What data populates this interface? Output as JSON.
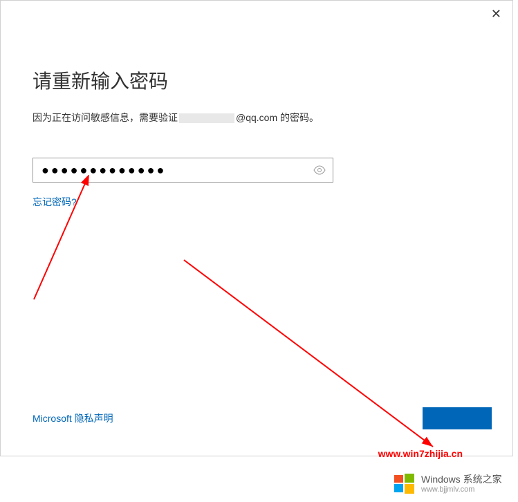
{
  "dialog": {
    "title": "请重新输入密码",
    "subtitle_prefix": "因为正在访问敏感信息，需要验证",
    "email_suffix": "@qq.com",
    "subtitle_suffix": " 的密码。"
  },
  "password": {
    "value": "●●●●●●●●●●●●●",
    "placeholder": ""
  },
  "links": {
    "forgot_password": "忘记密码?",
    "privacy": "Microsoft 隐私声明"
  },
  "watermark": {
    "url": "www.win7zhijia.cn",
    "brand_main": "Windows 系统之家",
    "brand_sub": "www.bjjmlv.com"
  }
}
